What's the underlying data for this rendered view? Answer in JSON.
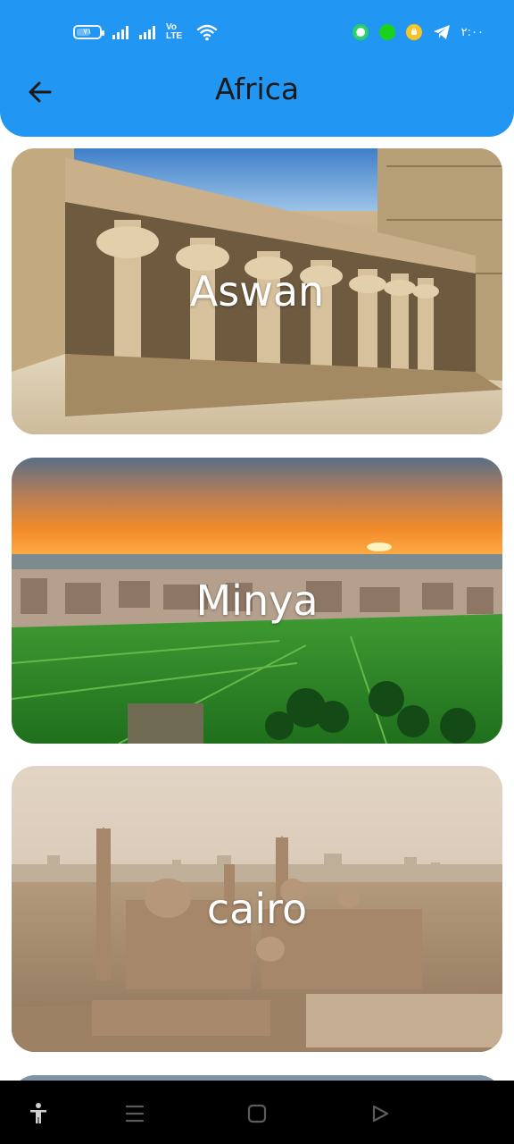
{
  "status_bar": {
    "battery_text": "٧١",
    "network_type": "Vo LTE",
    "sim1_label": "1",
    "sim2_label": "2",
    "time": "٢:٠٠"
  },
  "app_bar": {
    "title": "Africa",
    "back_icon": "arrow-left-icon"
  },
  "cities": [
    {
      "name": "Aswan"
    },
    {
      "name": "Minya"
    },
    {
      "name": "cairo"
    }
  ],
  "nav_bar": {
    "icons": [
      "accessibility-icon",
      "menu-icon",
      "home-icon",
      "back-triangle-icon"
    ]
  },
  "colors": {
    "header": "#2196f3",
    "title_text": "#1a1a1a",
    "label_text": "#ffffff",
    "nav_bar": "#000000"
  }
}
